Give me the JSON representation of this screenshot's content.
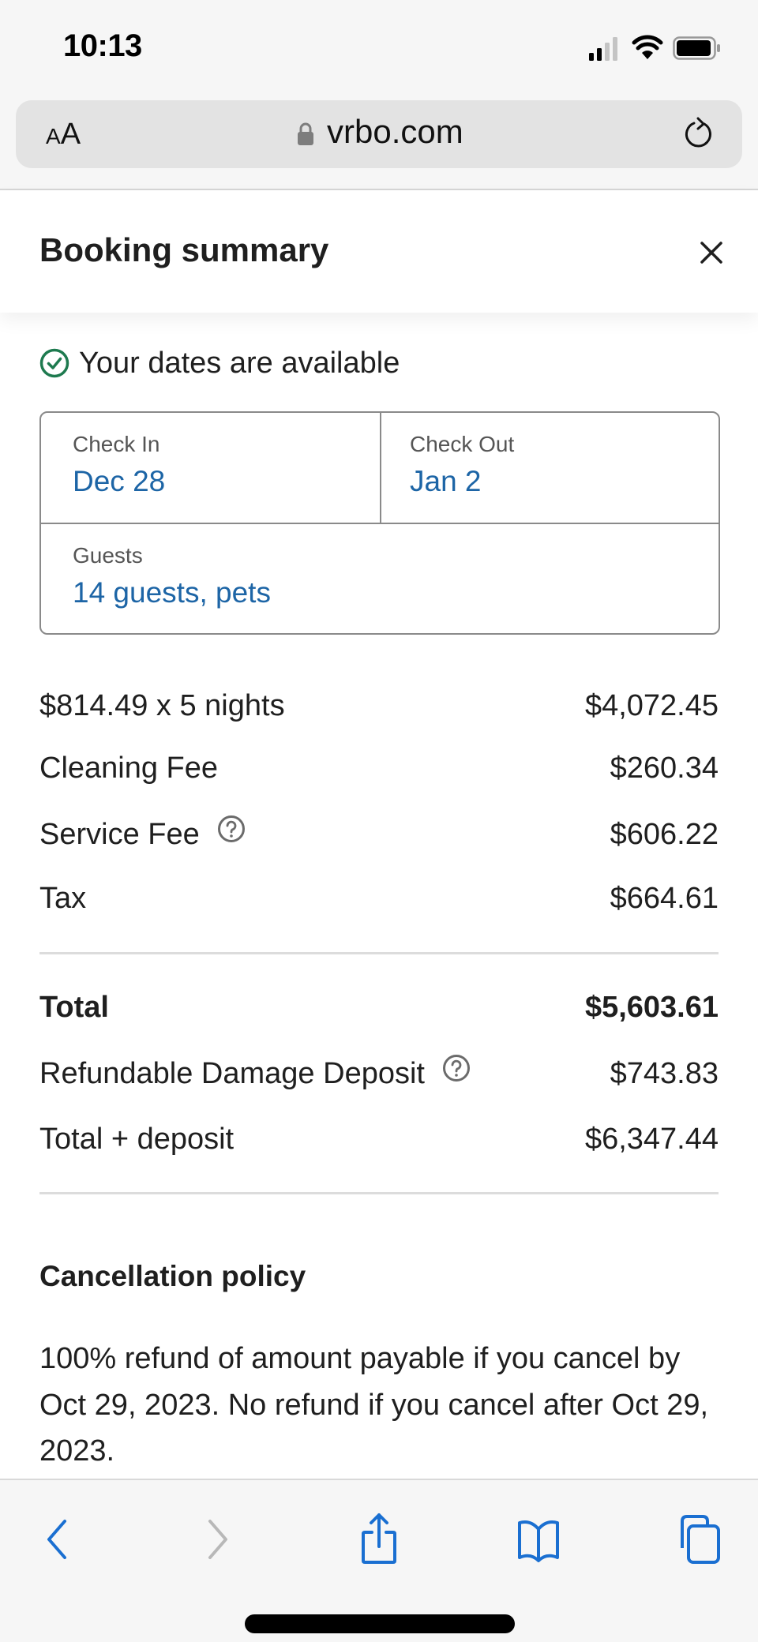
{
  "status_bar": {
    "time": "10:13",
    "icons": [
      "cellular-signal-icon",
      "wifi-icon",
      "battery-icon"
    ]
  },
  "browser": {
    "text_size_label_small": "A",
    "text_size_label_large": "A",
    "domain": "vrbo.com",
    "lock_icon": "lock-icon",
    "reload_icon": "reload-icon"
  },
  "header": {
    "title": "Booking summary",
    "close_icon": "close-icon"
  },
  "availability": {
    "icon": "check-circle-icon",
    "text": "Your dates are available",
    "color": "#1e7a4f"
  },
  "dates": {
    "check_in_label": "Check In",
    "check_in_value": "Dec 28",
    "check_out_label": "Check Out",
    "check_out_value": "Jan 2",
    "guests_label": "Guests",
    "guests_value": "14 guests, pets",
    "value_color": "#1d65a6"
  },
  "price_breakdown": [
    {
      "label": "$814.49 x 5 nights",
      "amount": "$4,072.45",
      "help": false
    },
    {
      "label": "Cleaning Fee",
      "amount": "$260.34",
      "help": false
    },
    {
      "label": "Service Fee",
      "amount": "$606.22",
      "help": true
    },
    {
      "label": "Tax",
      "amount": "$664.61",
      "help": false
    }
  ],
  "totals": [
    {
      "label": "Total",
      "amount": "$5,603.61",
      "bold": true,
      "help": false
    },
    {
      "label": "Refundable Damage Deposit",
      "amount": "$743.83",
      "bold": false,
      "help": true
    },
    {
      "label": "Total + deposit",
      "amount": "$6,347.44",
      "bold": false,
      "help": false
    }
  ],
  "cancellation": {
    "title": "Cancellation policy",
    "text": "100% refund of amount payable if you cancel by Oct 29, 2023. No refund if you cancel after Oct 29, 2023."
  },
  "toolbar": {
    "items": [
      "back-icon",
      "forward-icon",
      "share-icon",
      "bookmarks-icon",
      "tabs-icon"
    ],
    "accent_color": "#1a6fd1",
    "disabled_color": "#b8b8b8"
  }
}
